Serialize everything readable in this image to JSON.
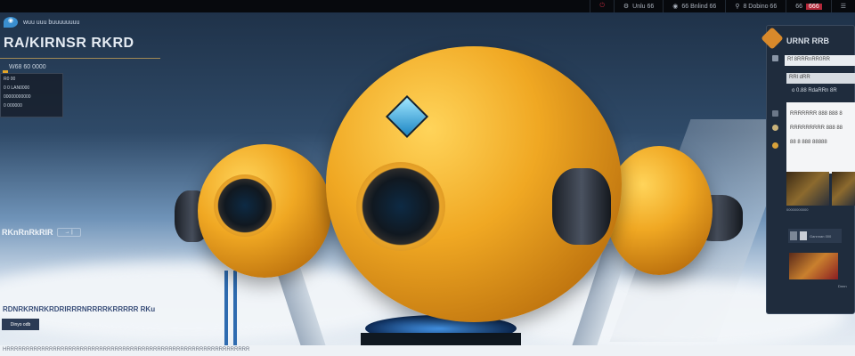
{
  "topbar": {
    "items": [
      "Unlu 66",
      "66 Bnlind 66",
      "8 Dobino 66",
      "66"
    ],
    "alert": "666"
  },
  "brand": {
    "name": "wuu uuu buuuuuuuu"
  },
  "hero": {
    "title": "RA/KIRNSR RKRD",
    "subnav": "W68 60 0000",
    "card_lines": [
      "R0 00",
      "0 0 LAN0000",
      "00000000000",
      "0 000000"
    ],
    "tag": "RKnRnRkRIR",
    "tag_pill": "→ |",
    "desc": "RDNRKRNRKRDRIRRRNRRRRKRRRRR RKu",
    "cta": "Dinyo odb"
  },
  "footer": "HRRRRRRRRRRRRRRRRRRRRRRRRRRRRRRRRRRRRRRRRRRRRRRRRRRRRRRRRRRRRRRR",
  "panel": {
    "title": "URNR RRB",
    "search": "Rf 8RRRnRR0RR",
    "field2": "RRl dRR",
    "option": "o 0.88 RdaRRn 8R",
    "box_lines": [
      "RRRRRRR 888 888 8",
      "RRRRRRRRR 888 88",
      "88 8 888 88888"
    ],
    "thumb_caption": "00000000000",
    "list_text": "Gannnan 000",
    "promo_text": "Dnnn"
  }
}
